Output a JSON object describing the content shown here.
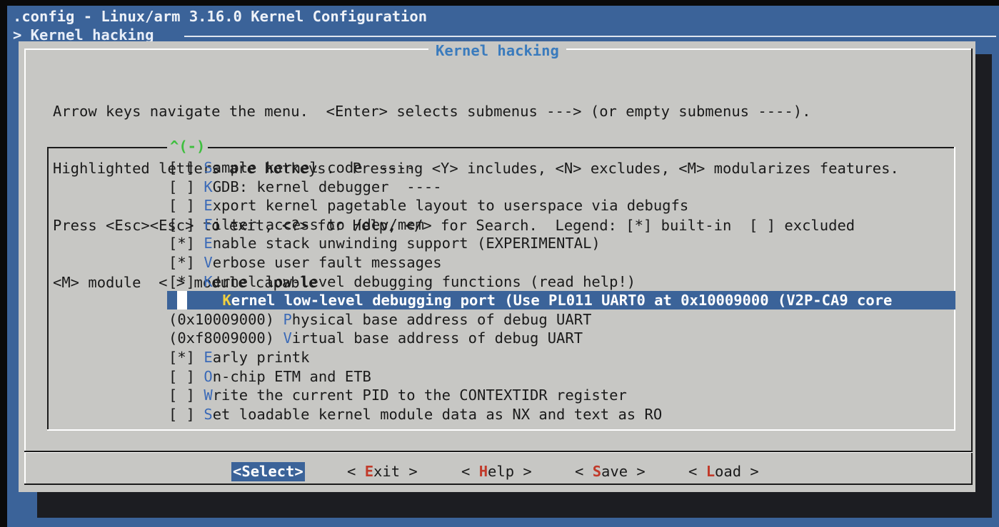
{
  "header": {
    "title": ".config - Linux/arm 3.16.0 Kernel Configuration",
    "breadcrumb": "> Kernel hacking"
  },
  "dialog": {
    "title": "Kernel hacking",
    "help": [
      "Arrow keys navigate the menu.  <Enter> selects submenus ---> (or empty submenus ----).",
      "Highlighted letters are hotkeys.  Pressing <Y> includes, <N> excludes, <M> modularizes features.",
      "Press <Esc><Esc> to exit, <?> for Help, </> for Search.  Legend: [*] built-in  [ ] excluded",
      "<M> module  < > module capable"
    ],
    "scroll_indicator": "^(-)"
  },
  "menu": {
    "items": [
      {
        "prefix": "[ ] ",
        "hotkey": "S",
        "rest": "ample kernel code  ----"
      },
      {
        "prefix": "[ ] ",
        "hotkey": "K",
        "rest": "GDB: kernel debugger  ----"
      },
      {
        "prefix": "[ ] ",
        "hotkey": "E",
        "rest": "xport kernel pagetable layout to userspace via debugfs"
      },
      {
        "prefix": "[ ] ",
        "hotkey": "F",
        "rest": "ilter access to /dev/mem"
      },
      {
        "prefix": "[*] ",
        "hotkey": "E",
        "rest": "nable stack unwinding support (EXPERIMENTAL)"
      },
      {
        "prefix": "[*] ",
        "hotkey": "V",
        "rest": "erbose user fault messages"
      },
      {
        "prefix": "[*] ",
        "hotkey": "K",
        "rest": "ernel low-level debugging functions (read help!)"
      },
      {
        "prefix": "    ",
        "hotkey": "K",
        "rest": "ernel low-level debugging port (Use PL011 UART0 at 0x10009000 (V2P-CA9 core"
      },
      {
        "prefix": "(0x10009000) ",
        "hotkey": "P",
        "rest": "hysical base address of debug UART"
      },
      {
        "prefix": "(0xf8009000) ",
        "hotkey": "V",
        "rest": "irtual base address of debug UART"
      },
      {
        "prefix": "[*] ",
        "hotkey": "E",
        "rest": "arly printk"
      },
      {
        "prefix": "[ ] ",
        "hotkey": "O",
        "rest": "n-chip ETM and ETB"
      },
      {
        "prefix": "[ ] ",
        "hotkey": "W",
        "rest": "rite the current PID to the CONTEXTIDR register"
      },
      {
        "prefix": "[ ] ",
        "hotkey": "S",
        "rest": "et loadable kernel module data as NX and text as RO"
      }
    ]
  },
  "buttons": {
    "select": {
      "pre": "<",
      "hotkey": "S",
      "post": "elect>"
    },
    "exit": {
      "pre": "< ",
      "hotkey": "E",
      "post": "xit >"
    },
    "help": {
      "pre": "< ",
      "hotkey": "H",
      "post": "elp >"
    },
    "save": {
      "pre": "< ",
      "hotkey": "S",
      "post": "ave >"
    },
    "load": {
      "pre": "< ",
      "hotkey": "L",
      "post": "oad >"
    }
  },
  "colors": {
    "background_blue": "#3b6399",
    "dialog_gray": "#c7c7c4",
    "hotkey_blue": "#3b6ab7",
    "button_hotkey_red": "#c13a2a",
    "title_blue": "#3a7bbd",
    "scroll_green": "#3fbf3f",
    "selected_hotkey_yellow": "#f0d040"
  }
}
